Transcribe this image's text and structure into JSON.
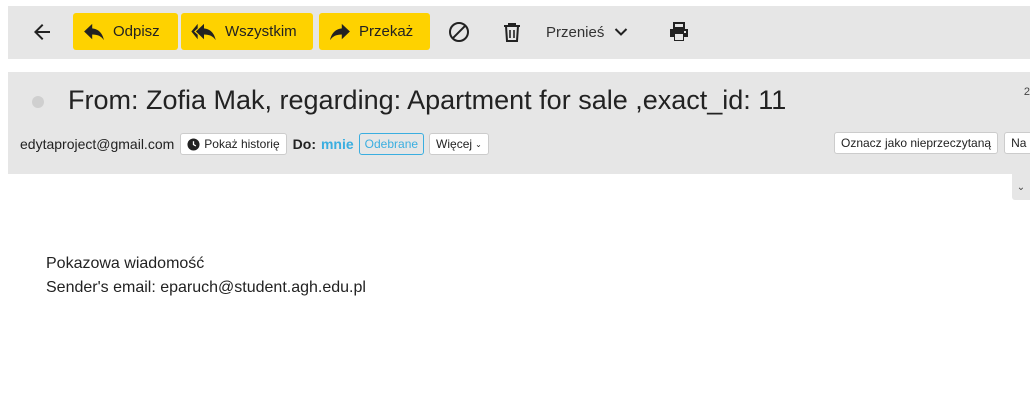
{
  "toolbar": {
    "back_icon": "arrow-left-icon",
    "reply_label": "Odpisz",
    "reply_all_label": "Wszystkim",
    "forward_label": "Przekaż",
    "spam_icon": "block-icon",
    "delete_icon": "trash-icon",
    "move_label": "Przenieś",
    "print_icon": "printer-icon",
    "accent_color": "#fed200"
  },
  "header": {
    "subject": "From: Zofia Mak, regarding: Apartment for sale ,exact_id: 11",
    "corner_text": "2",
    "sender": "edytaproject@gmail.com",
    "history_label": "Pokaż historię",
    "to_label": "Do:",
    "to_value": "mnie",
    "received_badge": "Odebrane",
    "more_label": "Więcej",
    "mark_unread_label": "Oznacz jako nieprzeczytaną",
    "truncated_button_label": "Na",
    "link_color": "#3aaee0"
  },
  "body": {
    "line1": "Pokazowa wiadomość",
    "line2": "Sender's email: eparuch@student.agh.edu.pl"
  }
}
